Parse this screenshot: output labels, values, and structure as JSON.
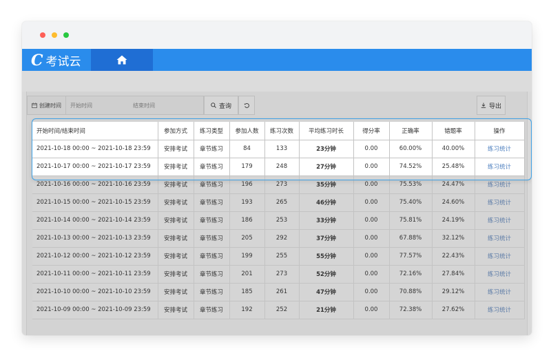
{
  "window": {
    "dots": [
      {
        "name": "close",
        "color": "#fe5f57"
      },
      {
        "name": "minimize",
        "color": "#febc2e"
      },
      {
        "name": "maximize",
        "color": "#28c840"
      }
    ]
  },
  "appbar": {
    "brand": "考试云",
    "logo_mark": "C",
    "home_icon": "home-icon",
    "bg_color": "#2a8cec",
    "active_tab_color": "#1f6ed4"
  },
  "toolbar": {
    "date_label": "创建时间",
    "calendar_icon": "calendar-icon",
    "start_placeholder": "开始时间",
    "end_placeholder": "结束时间",
    "search_label": "查询",
    "search_icon": "search-icon",
    "reset_icon": "refresh-icon",
    "export_label": "导出",
    "export_icon": "download-icon"
  },
  "table": {
    "columns": [
      "开始时间/结束时间",
      "参加方式",
      "练习类型",
      "参加人数",
      "练习次数",
      "平均练习时长",
      "得分率",
      "正确率",
      "错题率",
      "操作"
    ],
    "rows": [
      {
        "range": "2021-10-18 00:00 ~ 2021-10-18 23:59",
        "mode": "安排考试",
        "type": "章节练习",
        "people": "84",
        "times": "133",
        "avg": "23分钟",
        "score": "0.00",
        "correct": "60.00%",
        "wrong": "40.00%",
        "action": "练习统计"
      },
      {
        "range": "2021-10-17 00:00 ~ 2021-10-17 23:59",
        "mode": "安排考试",
        "type": "章节练习",
        "people": "179",
        "times": "248",
        "avg": "27分钟",
        "score": "0.00",
        "correct": "74.52%",
        "wrong": "25.48%",
        "action": "练习统计"
      },
      {
        "range": "2021-10-16 00:00 ~ 2021-10-16 23:59",
        "mode": "安排考试",
        "type": "章节练习",
        "people": "196",
        "times": "273",
        "avg": "35分钟",
        "score": "0.00",
        "correct": "75.53%",
        "wrong": "24.47%",
        "action": "练习统计"
      },
      {
        "range": "2021-10-15 00:00 ~ 2021-10-15 23:59",
        "mode": "安排考试",
        "type": "章节练习",
        "people": "193",
        "times": "265",
        "avg": "46分钟",
        "score": "0.00",
        "correct": "75.40%",
        "wrong": "24.60%",
        "action": "练习统计"
      },
      {
        "range": "2021-10-14 00:00 ~ 2021-10-14 23:59",
        "mode": "安排考试",
        "type": "章节练习",
        "people": "186",
        "times": "253",
        "avg": "33分钟",
        "score": "0.00",
        "correct": "75.81%",
        "wrong": "24.19%",
        "action": "练习统计"
      },
      {
        "range": "2021-10-13 00:00 ~ 2021-10-13 23:59",
        "mode": "安排考试",
        "type": "章节练习",
        "people": "205",
        "times": "292",
        "avg": "37分钟",
        "score": "0.00",
        "correct": "67.88%",
        "wrong": "32.12%",
        "action": "练习统计"
      },
      {
        "range": "2021-10-12 00:00 ~ 2021-10-12 23:59",
        "mode": "安排考试",
        "type": "章节练习",
        "people": "199",
        "times": "255",
        "avg": "55分钟",
        "score": "0.00",
        "correct": "77.57%",
        "wrong": "22.43%",
        "action": "练习统计"
      },
      {
        "range": "2021-10-11 00:00 ~ 2021-10-11 23:59",
        "mode": "安排考试",
        "type": "章节练习",
        "people": "201",
        "times": "273",
        "avg": "52分钟",
        "score": "0.00",
        "correct": "72.16%",
        "wrong": "27.84%",
        "action": "练习统计"
      },
      {
        "range": "2021-10-10 00:00 ~ 2021-10-10 23:59",
        "mode": "安排考试",
        "type": "章节练习",
        "people": "185",
        "times": "261",
        "avg": "47分钟",
        "score": "0.00",
        "correct": "70.88%",
        "wrong": "29.12%",
        "action": "练习统计"
      },
      {
        "range": "2021-10-09 00:00 ~ 2021-10-09 23:59",
        "mode": "安排考试",
        "type": "章节练习",
        "people": "192",
        "times": "252",
        "avg": "21分钟",
        "score": "0.00",
        "correct": "72.38%",
        "wrong": "27.62%",
        "action": "练习统计"
      }
    ],
    "link_color": "#4d7fbf",
    "highlight_color": "#3ea1e6"
  }
}
